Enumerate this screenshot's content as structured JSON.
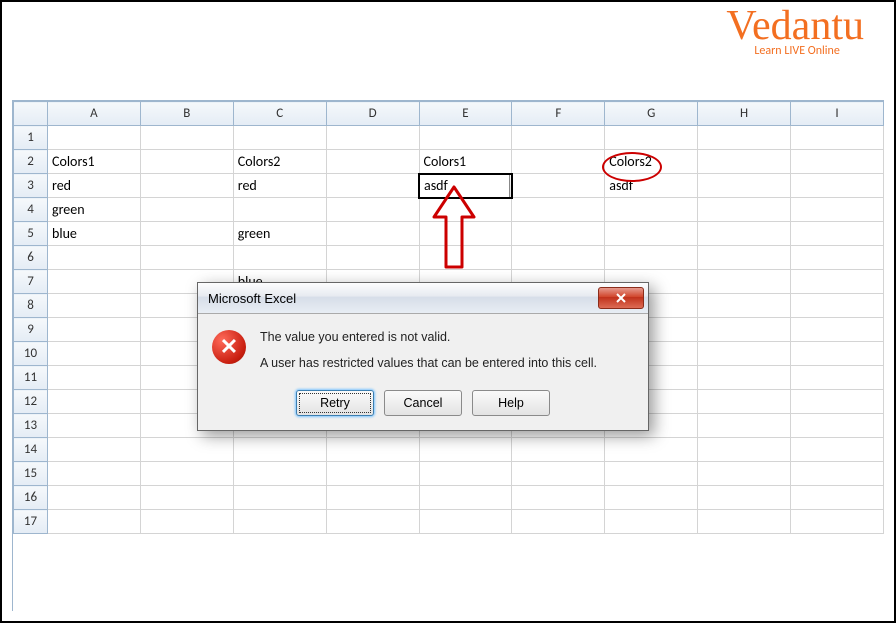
{
  "logo": {
    "main": "Vedantu",
    "sub": "Learn LIVE Online"
  },
  "columns": [
    "A",
    "B",
    "C",
    "D",
    "E",
    "F",
    "G",
    "H",
    "I"
  ],
  "selected_col_idx": 4,
  "selected_row_idx": 3,
  "cells": {
    "A2": "Colors1",
    "C2": "Colors2",
    "E2": "Colors1",
    "G2": "Colors2",
    "A3": "red",
    "C3": "red",
    "E3": "asdf",
    "G3": "asdf",
    "A4": "green",
    "A5": "blue",
    "C5": "green",
    "C7": "blue"
  },
  "bold_cells": [
    "A2",
    "C2",
    "E2",
    "G2"
  ],
  "active_cell": "E3",
  "row_count": 17,
  "dialog": {
    "title": "Microsoft Excel",
    "line1": "The value you entered is not valid.",
    "line2": "A user has restricted values that can be entered into this cell.",
    "buttons": {
      "retry": "Retry",
      "cancel": "Cancel",
      "help": "Help"
    }
  }
}
